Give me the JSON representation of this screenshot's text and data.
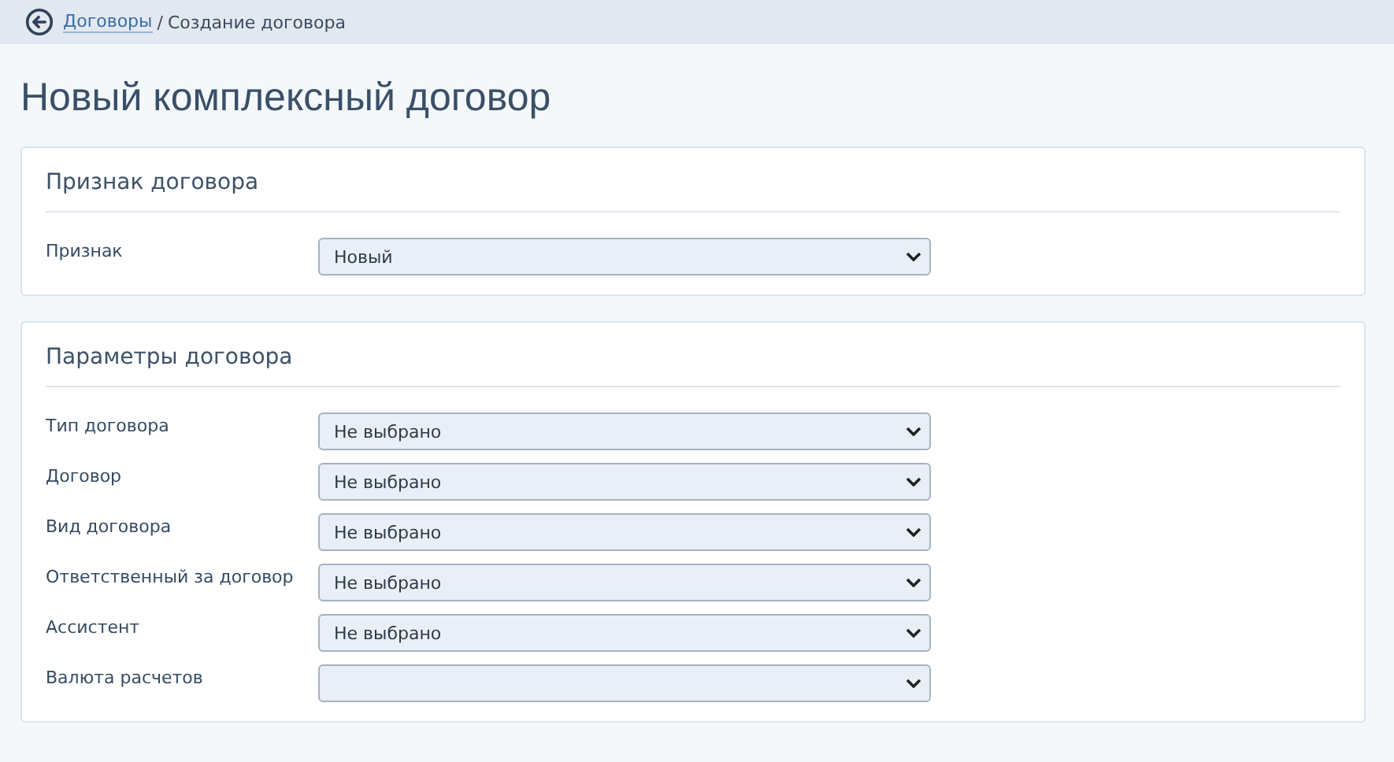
{
  "breadcrumb": {
    "link": "Договоры",
    "separator": "/",
    "current": "Создание договора"
  },
  "title": "Новый комплексный договор",
  "sections": [
    {
      "title": "Признак договора",
      "fields": [
        {
          "label": "Признак",
          "value": "Новый"
        }
      ]
    },
    {
      "title": "Параметры договора",
      "fields": [
        {
          "label": "Тип договора",
          "value": "Не выбрано"
        },
        {
          "label": "Договор",
          "value": "Не выбрано"
        },
        {
          "label": "Вид договора",
          "value": "Не выбрано"
        },
        {
          "label": "Ответственный за договор",
          "value": "Не выбрано"
        },
        {
          "label": "Ассистент",
          "value": "Не выбрано"
        },
        {
          "label": "Валюта расчетов"
        }
      ]
    }
  ]
}
